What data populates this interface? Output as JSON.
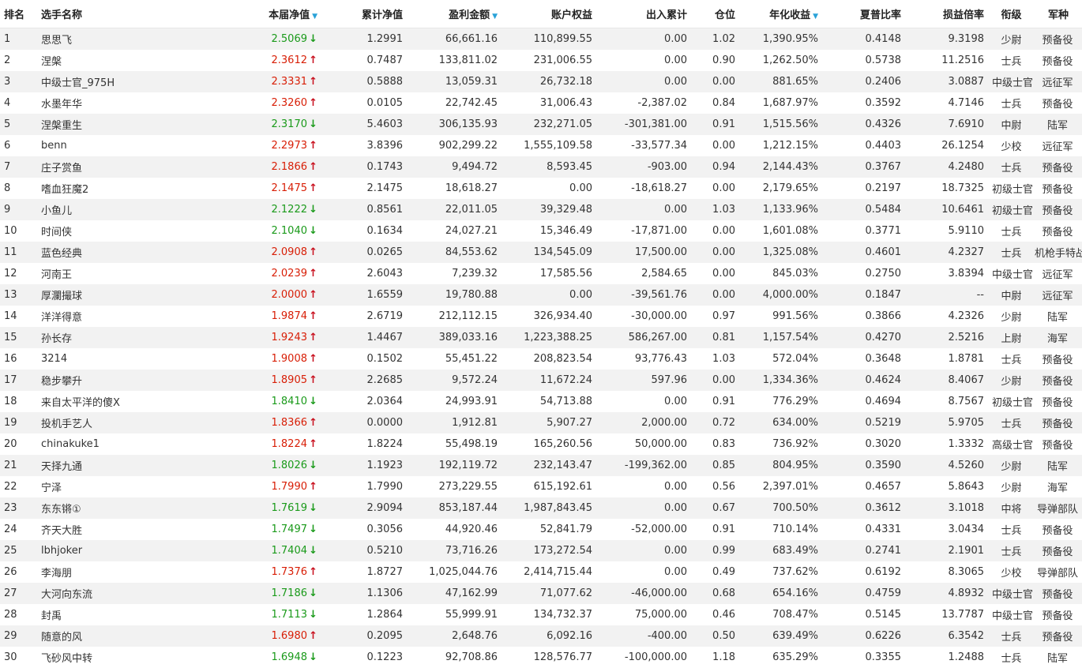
{
  "header": {
    "rank": "排名",
    "name": "选手名称",
    "current_nav": "本届净值",
    "cumulative_nav": "累计净值",
    "profit": "盈利金额",
    "equity": "账户权益",
    "flows": "出入累计",
    "position": "仓位",
    "annual_return": "年化收益",
    "sharpe": "夏普比率",
    "pl_ratio": "损益倍率",
    "military_rank": "衔级",
    "army": "军种"
  },
  "sort_indicator": "▼",
  "rows": [
    {
      "rank": "1",
      "name": "思思飞",
      "nav": "2.5069",
      "trend": "down",
      "cum": "1.2991",
      "profit": "66,661.16",
      "equity": "110,899.55",
      "flow": "0.00",
      "pos": "1.02",
      "ann": "1,390.95%",
      "sharpe": "0.4148",
      "ratio": "9.3198",
      "mrank": "少尉",
      "army": "预备役"
    },
    {
      "rank": "2",
      "name": "涅槃",
      "nav": "2.3612",
      "trend": "up",
      "cum": "0.7487",
      "profit": "133,811.02",
      "equity": "231,006.55",
      "flow": "0.00",
      "pos": "0.90",
      "ann": "1,262.50%",
      "sharpe": "0.5738",
      "ratio": "11.2516",
      "mrank": "士兵",
      "army": "预备役"
    },
    {
      "rank": "3",
      "name": "中级士官_975H",
      "nav": "2.3331",
      "trend": "up",
      "cum": "0.5888",
      "profit": "13,059.31",
      "equity": "26,732.18",
      "flow": "0.00",
      "pos": "0.00",
      "ann": "881.65%",
      "sharpe": "0.2406",
      "ratio": "3.0887",
      "mrank": "中级士官",
      "army": "远征军"
    },
    {
      "rank": "4",
      "name": "水墨年华",
      "nav": "2.3260",
      "trend": "up",
      "cum": "0.0105",
      "profit": "22,742.45",
      "equity": "31,006.43",
      "flow": "-2,387.02",
      "pos": "0.84",
      "ann": "1,687.97%",
      "sharpe": "0.3592",
      "ratio": "4.7146",
      "mrank": "士兵",
      "army": "预备役"
    },
    {
      "rank": "5",
      "name": "涅槃重生",
      "nav": "2.3170",
      "trend": "down",
      "cum": "5.4603",
      "profit": "306,135.93",
      "equity": "232,271.05",
      "flow": "-301,381.00",
      "pos": "0.91",
      "ann": "1,515.56%",
      "sharpe": "0.4326",
      "ratio": "7.6910",
      "mrank": "中尉",
      "army": "陆军"
    },
    {
      "rank": "6",
      "name": "benn",
      "nav": "2.2973",
      "trend": "up",
      "cum": "3.8396",
      "profit": "902,299.22",
      "equity": "1,555,109.58",
      "flow": "-33,577.34",
      "pos": "0.00",
      "ann": "1,212.15%",
      "sharpe": "0.4403",
      "ratio": "26.1254",
      "mrank": "少校",
      "army": "远征军"
    },
    {
      "rank": "7",
      "name": "庄子赏鱼",
      "nav": "2.1866",
      "trend": "up",
      "cum": "0.1743",
      "profit": "9,494.72",
      "equity": "8,593.45",
      "flow": "-903.00",
      "pos": "0.94",
      "ann": "2,144.43%",
      "sharpe": "0.3767",
      "ratio": "4.2480",
      "mrank": "士兵",
      "army": "预备役"
    },
    {
      "rank": "8",
      "name": "嗜血狂魔2",
      "nav": "2.1475",
      "trend": "up",
      "cum": "2.1475",
      "profit": "18,618.27",
      "equity": "0.00",
      "flow": "-18,618.27",
      "pos": "0.00",
      "ann": "2,179.65%",
      "sharpe": "0.2197",
      "ratio": "18.7325",
      "mrank": "初级士官",
      "army": "预备役"
    },
    {
      "rank": "9",
      "name": "小鱼儿",
      "nav": "2.1222",
      "trend": "down",
      "cum": "0.8561",
      "profit": "22,011.05",
      "equity": "39,329.48",
      "flow": "0.00",
      "pos": "1.03",
      "ann": "1,133.96%",
      "sharpe": "0.5484",
      "ratio": "10.6461",
      "mrank": "初级士官",
      "army": "预备役"
    },
    {
      "rank": "10",
      "name": "时间侠",
      "nav": "2.1040",
      "trend": "down",
      "cum": "0.1634",
      "profit": "24,027.21",
      "equity": "15,346.49",
      "flow": "-17,871.00",
      "pos": "0.00",
      "ann": "1,601.08%",
      "sharpe": "0.3771",
      "ratio": "5.9110",
      "mrank": "士兵",
      "army": "预备役"
    },
    {
      "rank": "11",
      "name": "蓝色经典",
      "nav": "2.0908",
      "trend": "up",
      "cum": "0.0265",
      "profit": "84,553.62",
      "equity": "134,545.09",
      "flow": "17,500.00",
      "pos": "0.00",
      "ann": "1,325.08%",
      "sharpe": "0.4601",
      "ratio": "4.2327",
      "mrank": "士兵",
      "army": "机枪手特战营"
    },
    {
      "rank": "12",
      "name": "河南王",
      "nav": "2.0239",
      "trend": "up",
      "cum": "2.6043",
      "profit": "7,239.32",
      "equity": "17,585.56",
      "flow": "2,584.65",
      "pos": "0.00",
      "ann": "845.03%",
      "sharpe": "0.2750",
      "ratio": "3.8394",
      "mrank": "中级士官",
      "army": "远征军"
    },
    {
      "rank": "13",
      "name": "厚瀾撮球",
      "nav": "2.0000",
      "trend": "up",
      "cum": "1.6559",
      "profit": "19,780.88",
      "equity": "0.00",
      "flow": "-39,561.76",
      "pos": "0.00",
      "ann": "4,000.00%",
      "sharpe": "0.1847",
      "ratio": "--",
      "mrank": "中尉",
      "army": "远征军"
    },
    {
      "rank": "14",
      "name": "洋洋得意",
      "nav": "1.9874",
      "trend": "up",
      "cum": "2.6719",
      "profit": "212,112.15",
      "equity": "326,934.40",
      "flow": "-30,000.00",
      "pos": "0.97",
      "ann": "991.56%",
      "sharpe": "0.3866",
      "ratio": "4.2326",
      "mrank": "少尉",
      "army": "陆军"
    },
    {
      "rank": "15",
      "name": "孙长存",
      "nav": "1.9243",
      "trend": "up",
      "cum": "1.4467",
      "profit": "389,033.16",
      "equity": "1,223,388.25",
      "flow": "586,267.00",
      "pos": "0.81",
      "ann": "1,157.54%",
      "sharpe": "0.4270",
      "ratio": "2.5216",
      "mrank": "上尉",
      "army": "海军"
    },
    {
      "rank": "16",
      "name": "3214",
      "nav": "1.9008",
      "trend": "up",
      "cum": "0.1502",
      "profit": "55,451.22",
      "equity": "208,823.54",
      "flow": "93,776.43",
      "pos": "1.03",
      "ann": "572.04%",
      "sharpe": "0.3648",
      "ratio": "1.8781",
      "mrank": "士兵",
      "army": "预备役"
    },
    {
      "rank": "17",
      "name": "稳步攀升",
      "nav": "1.8905",
      "trend": "up",
      "cum": "2.2685",
      "profit": "9,572.24",
      "equity": "11,672.24",
      "flow": "597.96",
      "pos": "0.00",
      "ann": "1,334.36%",
      "sharpe": "0.4624",
      "ratio": "8.4067",
      "mrank": "少尉",
      "army": "预备役"
    },
    {
      "rank": "18",
      "name": "来自太平洋的傻X",
      "nav": "1.8410",
      "trend": "down",
      "cum": "2.0364",
      "profit": "24,993.91",
      "equity": "54,713.88",
      "flow": "0.00",
      "pos": "0.91",
      "ann": "776.29%",
      "sharpe": "0.4694",
      "ratio": "8.7567",
      "mrank": "初级士官",
      "army": "预备役"
    },
    {
      "rank": "19",
      "name": "投机手艺人",
      "nav": "1.8366",
      "trend": "up",
      "cum": "0.0000",
      "profit": "1,912.81",
      "equity": "5,907.27",
      "flow": "2,000.00",
      "pos": "0.72",
      "ann": "634.00%",
      "sharpe": "0.5219",
      "ratio": "5.9705",
      "mrank": "士兵",
      "army": "预备役"
    },
    {
      "rank": "20",
      "name": "chinakuke1",
      "nav": "1.8224",
      "trend": "up",
      "cum": "1.8224",
      "profit": "55,498.19",
      "equity": "165,260.56",
      "flow": "50,000.00",
      "pos": "0.83",
      "ann": "736.92%",
      "sharpe": "0.3020",
      "ratio": "1.3332",
      "mrank": "高级士官",
      "army": "预备役"
    },
    {
      "rank": "21",
      "name": "天择九通",
      "nav": "1.8026",
      "trend": "down",
      "cum": "1.1923",
      "profit": "192,119.72",
      "equity": "232,143.47",
      "flow": "-199,362.00",
      "pos": "0.85",
      "ann": "804.95%",
      "sharpe": "0.3590",
      "ratio": "4.5260",
      "mrank": "少尉",
      "army": "陆军"
    },
    {
      "rank": "22",
      "name": "宁泽",
      "nav": "1.7990",
      "trend": "up",
      "cum": "1.7990",
      "profit": "273,229.55",
      "equity": "615,192.61",
      "flow": "0.00",
      "pos": "0.56",
      "ann": "2,397.01%",
      "sharpe": "0.4657",
      "ratio": "5.8643",
      "mrank": "少尉",
      "army": "海军"
    },
    {
      "rank": "23",
      "name": "东东锵①",
      "nav": "1.7619",
      "trend": "down",
      "cum": "2.9094",
      "profit": "853,187.44",
      "equity": "1,987,843.45",
      "flow": "0.00",
      "pos": "0.67",
      "ann": "700.50%",
      "sharpe": "0.3612",
      "ratio": "3.1018",
      "mrank": "中将",
      "army": "导弹部队"
    },
    {
      "rank": "24",
      "name": "齐天大胜",
      "nav": "1.7497",
      "trend": "down",
      "cum": "0.3056",
      "profit": "44,920.46",
      "equity": "52,841.79",
      "flow": "-52,000.00",
      "pos": "0.91",
      "ann": "710.14%",
      "sharpe": "0.4331",
      "ratio": "3.0434",
      "mrank": "士兵",
      "army": "预备役"
    },
    {
      "rank": "25",
      "name": "lbhjoker",
      "nav": "1.7404",
      "trend": "down",
      "cum": "0.5210",
      "profit": "73,716.26",
      "equity": "173,272.54",
      "flow": "0.00",
      "pos": "0.99",
      "ann": "683.49%",
      "sharpe": "0.2741",
      "ratio": "2.1901",
      "mrank": "士兵",
      "army": "预备役"
    },
    {
      "rank": "26",
      "name": "李海朋",
      "nav": "1.7376",
      "trend": "up",
      "cum": "1.8727",
      "profit": "1,025,044.76",
      "equity": "2,414,715.44",
      "flow": "0.00",
      "pos": "0.49",
      "ann": "737.62%",
      "sharpe": "0.6192",
      "ratio": "8.3065",
      "mrank": "少校",
      "army": "导弹部队"
    },
    {
      "rank": "27",
      "name": "大河向东流",
      "nav": "1.7186",
      "trend": "down",
      "cum": "1.1306",
      "profit": "47,162.99",
      "equity": "71,077.62",
      "flow": "-46,000.00",
      "pos": "0.68",
      "ann": "654.16%",
      "sharpe": "0.4759",
      "ratio": "4.8932",
      "mrank": "中级士官",
      "army": "预备役"
    },
    {
      "rank": "28",
      "name": "封禹",
      "nav": "1.7113",
      "trend": "down",
      "cum": "1.2864",
      "profit": "55,999.91",
      "equity": "134,732.37",
      "flow": "75,000.00",
      "pos": "0.46",
      "ann": "708.47%",
      "sharpe": "0.5145",
      "ratio": "13.7787",
      "mrank": "中级士官",
      "army": "预备役"
    },
    {
      "rank": "29",
      "name": "随意的风",
      "nav": "1.6980",
      "trend": "up",
      "cum": "0.2095",
      "profit": "2,648.76",
      "equity": "6,092.16",
      "flow": "-400.00",
      "pos": "0.50",
      "ann": "639.49%",
      "sharpe": "0.6226",
      "ratio": "6.3542",
      "mrank": "士兵",
      "army": "预备役"
    },
    {
      "rank": "30",
      "name": "飞砂风中转",
      "nav": "1.6948",
      "trend": "down",
      "cum": "0.1223",
      "profit": "92,708.86",
      "equity": "128,576.77",
      "flow": "-100,000.00",
      "pos": "1.18",
      "ann": "635.29%",
      "sharpe": "0.3355",
      "ratio": "1.2488",
      "mrank": "士兵",
      "army": "陆军"
    }
  ]
}
